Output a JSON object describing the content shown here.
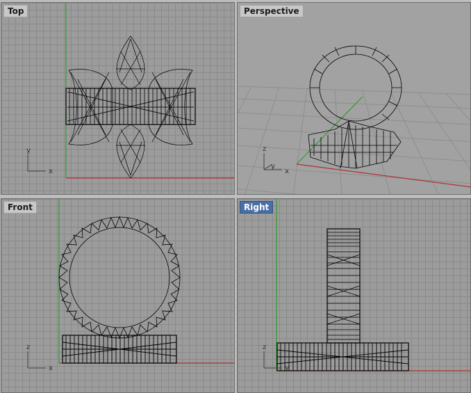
{
  "viewports": {
    "top": {
      "label": "Top",
      "axis1": "x",
      "axis2": "y"
    },
    "perspective": {
      "label": "Perspective",
      "axis1": "x",
      "axis2": "y",
      "axis3": "z"
    },
    "front": {
      "label": "Front",
      "axis1": "x",
      "axis2": "z"
    },
    "right": {
      "label": "Right",
      "axis1": "y",
      "axis2": "z"
    }
  },
  "colors": {
    "viewport_bg": "#9c9c9c",
    "grid": "#8a8a8a",
    "axis_x": "#b03030",
    "axis_y": "#2f9e2f",
    "wire": "#000000",
    "active_label": "#4a6fa5"
  }
}
